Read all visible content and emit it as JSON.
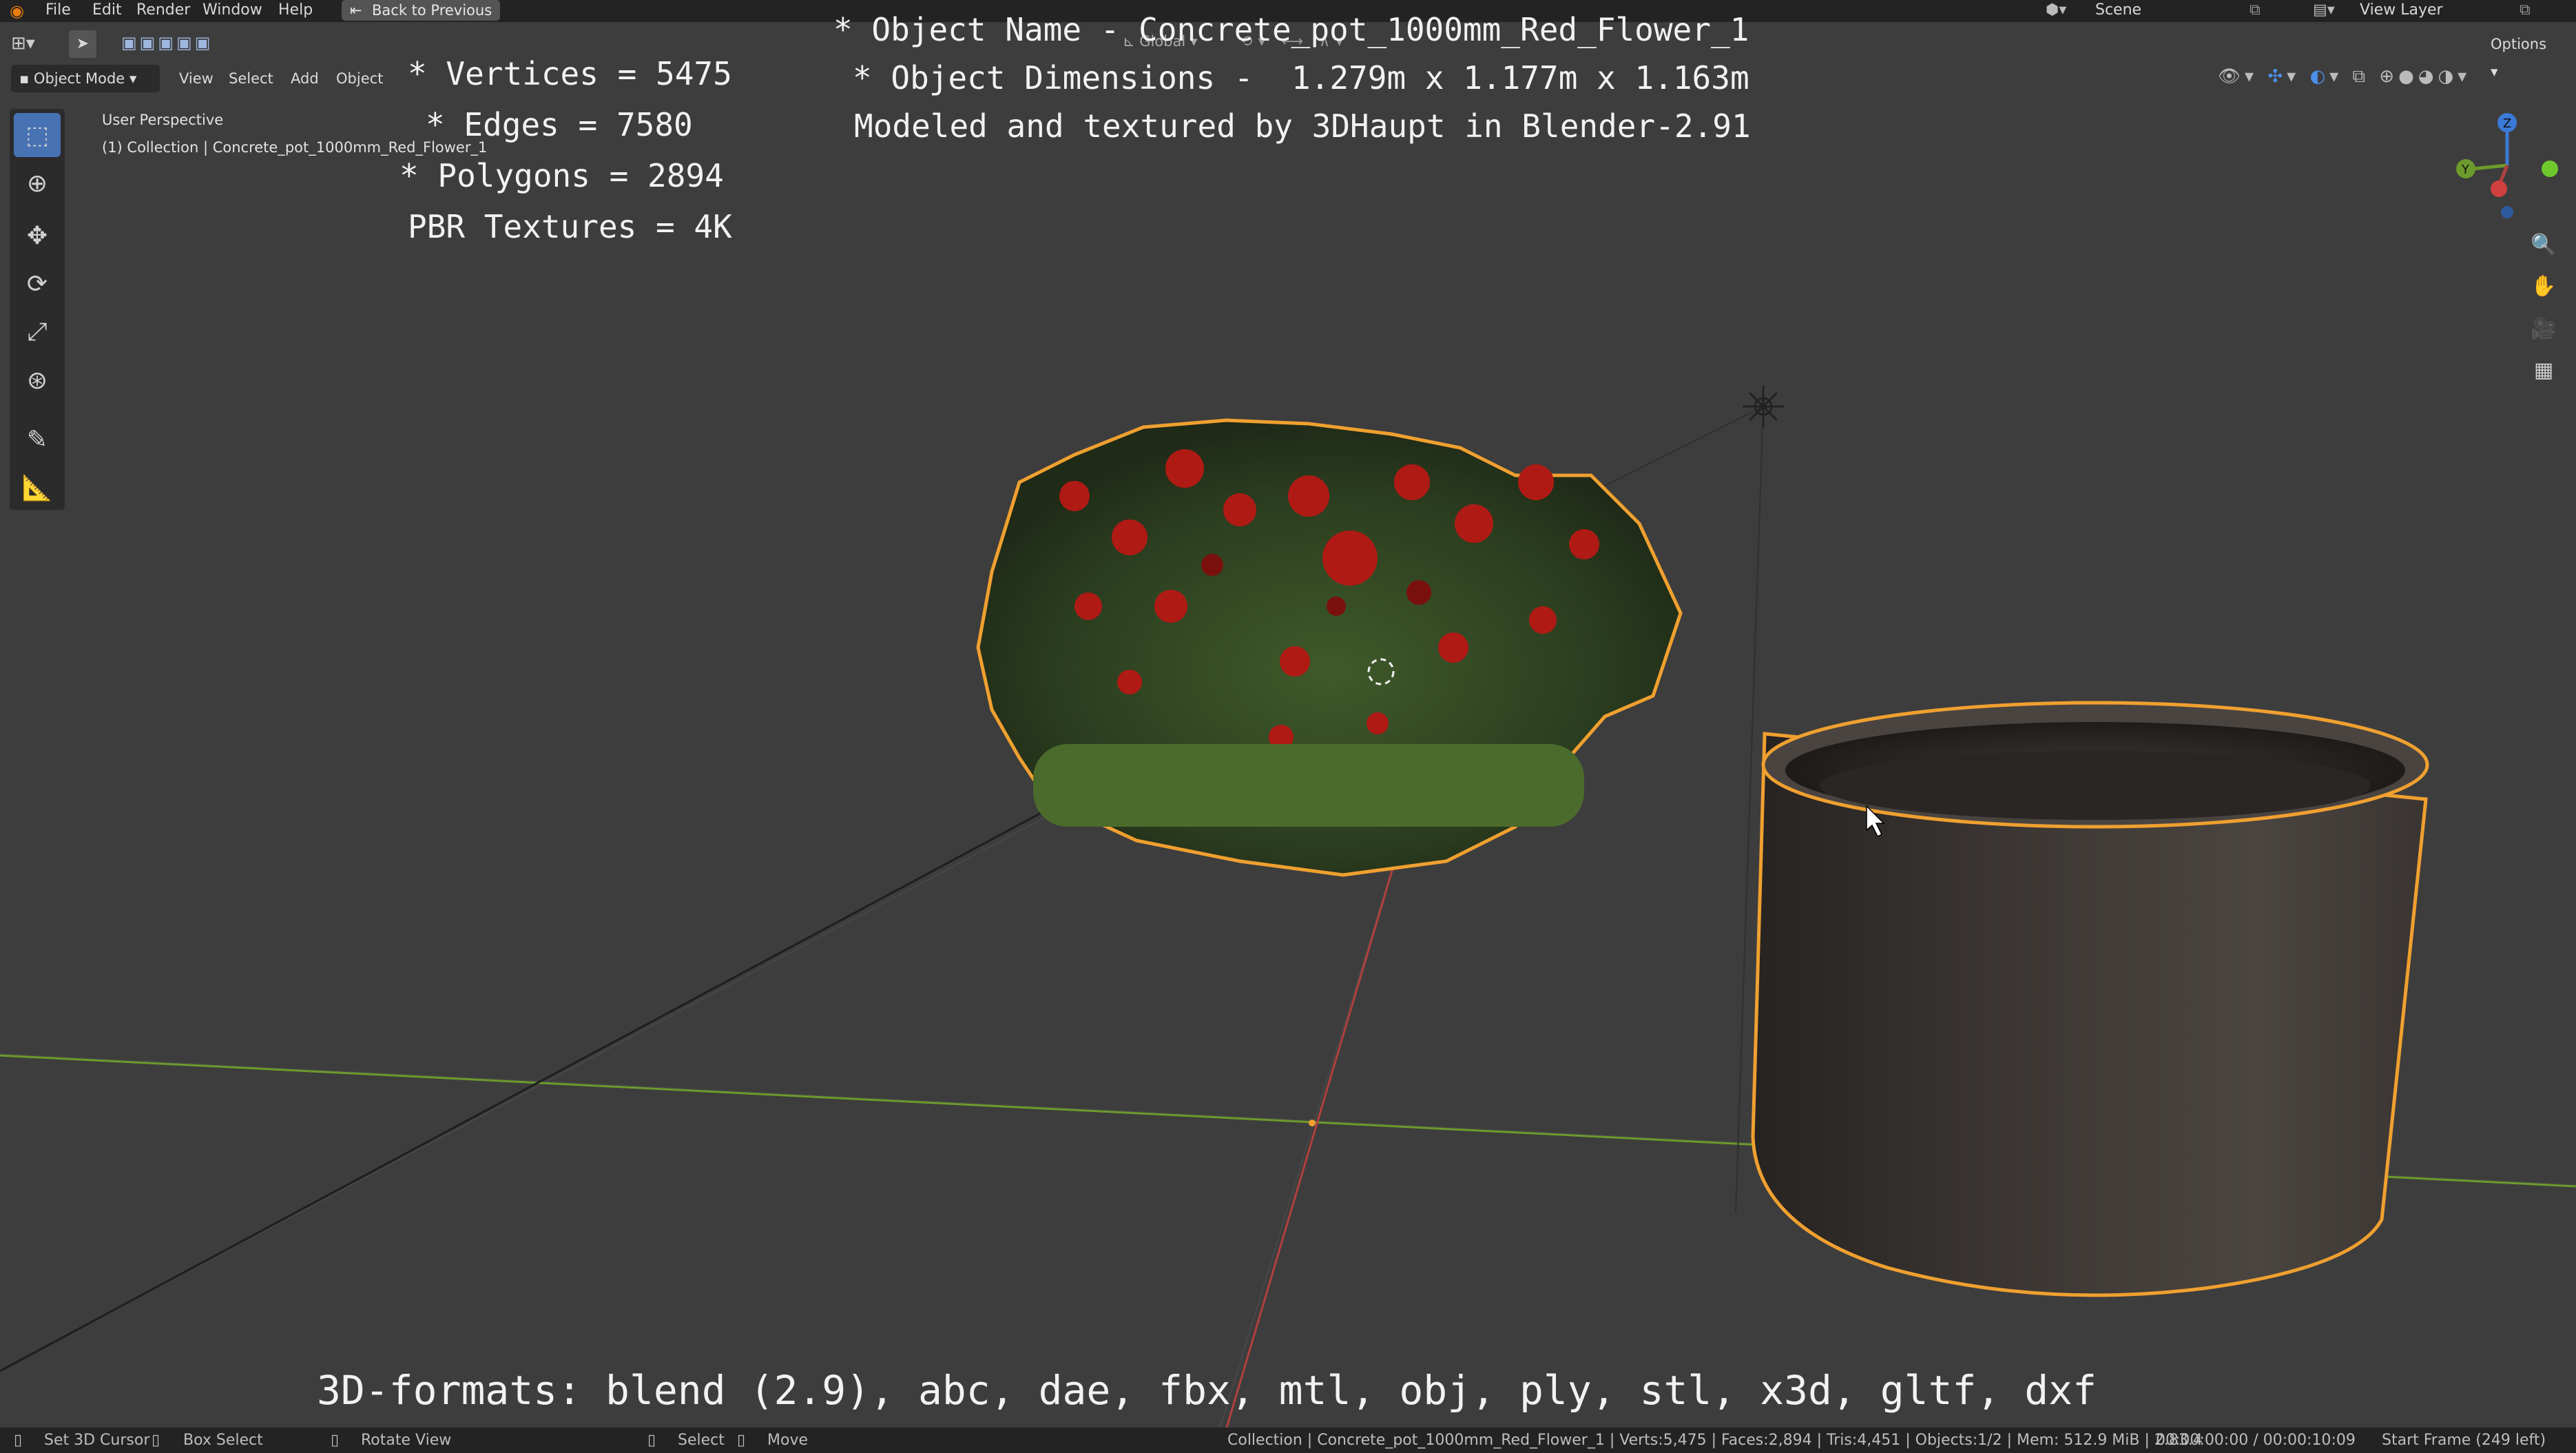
{
  "menu": {
    "items": [
      "File",
      "Edit",
      "Render",
      "Window",
      "Help"
    ],
    "back_button": "Back to Previous",
    "scene_label": "Scene",
    "view_layer_label": "View Layer"
  },
  "header": {
    "mode": "Object Mode",
    "menus": [
      "View",
      "Select",
      "Add",
      "Object"
    ],
    "transform_orientation": "Global",
    "options": "Options"
  },
  "viewport": {
    "perspective_label": "User Perspective",
    "collection_label": "(1) Collection | Concrete_pot_1000mm_Red_Flower_1"
  },
  "overlay": {
    "stats": [
      "* Vertices = 5475",
      "* Edges = 7580",
      "* Polygons = 2894",
      "PBR Textures = 4K"
    ],
    "info": [
      "* Object Name - Concrete_pot_1000mm_Red_Flower_1",
      "* Object Dimensions -  1.279m x 1.177m x 1.163m",
      "Modeled and textured by 3DHaupt in Blender-2.91"
    ],
    "formats": "3D-formats: blend (2.9), abc, dae, fbx, mtl, obj, ply, stl, x3d, gltf, dxf"
  },
  "statusbar": {
    "set_cursor": "Set 3D Cursor",
    "box_select": "Box Select",
    "rotate_view": "Rotate View",
    "select": "Select",
    "move": "Move",
    "scene_stats": "Collection | Concrete_pot_1000mm_Red_Flower_1 | Verts:5,475 | Faces:2,894 | Tris:4,451 | Objects:1/2 | Mem: 512.9 MiB | 2.83.4",
    "time": "00:00:00:00 / 00:00:10:09",
    "start_frame": "Start Frame (249 left)"
  },
  "colors": {
    "background": "#3d3d3d",
    "bars": "#232323",
    "accent": "#4772b3",
    "selection_outline": "#f0a030",
    "x_axis": "#b0403f",
    "y_axis": "#6c9a2c",
    "z_axis": "#3b79d6"
  },
  "icons": [
    "blender-logo-icon",
    "select-box-icon",
    "cursor-icon",
    "move-icon",
    "rotate-icon",
    "scale-icon",
    "transform-icon",
    "annotate-icon",
    "measure-icon",
    "zoom-icon",
    "hand-icon",
    "camera-icon",
    "grid-icon"
  ]
}
